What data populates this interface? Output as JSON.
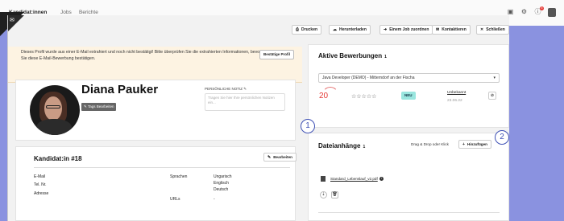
{
  "nav": {
    "tabs": [
      {
        "label": "Kandidat:innen",
        "active": true
      },
      {
        "label": "Jobs",
        "active": false
      },
      {
        "label": "Berichte",
        "active": false
      }
    ],
    "badge_count": "5"
  },
  "toolbar": {
    "print": "Drucken",
    "download": "Herunterladen",
    "assign_job": "Einem Job zuordnen",
    "contact": "Kontaktieren",
    "close": "Schließen"
  },
  "banner": {
    "text": "Dieses Profil wurde aus einer E-Mail extrahiert und noch nicht bestätigt! Bitte überprüfen Sie die extrahierten Informationen, bevor Sie diese E-Mail-Bewerbung bestätigen.",
    "confirm_label": "Bestätige Profil"
  },
  "profile": {
    "name": "Diana Pauker",
    "tags_button": "Tags Bearbeiten",
    "note_label": "PERSÖNLICHE NOTIZ",
    "note_placeholder": "Tragen Sie hier Ihre persönlichen Notizen ein..."
  },
  "candidate": {
    "title": "Kandidat:in #18",
    "edit": "Bearbeiten",
    "email_label": "E-Mail",
    "phone_label": "Tel. Nr.",
    "address_label": "Adresse",
    "languages_label": "Sprachen",
    "languages": [
      "Ungarisch",
      "Englisch",
      "Deutsch"
    ],
    "urls_label": "URLs",
    "urls_value": "-"
  },
  "applications": {
    "title": "Aktive Bewerbungen",
    "count": "1",
    "selected_job": "Java Developer (DEMO) - Mitterndorf an der Fischa",
    "score": "20",
    "stars": "☆☆☆☆☆",
    "status_badge": "NEU",
    "stage": "Unbekannt",
    "date": "23.06.22"
  },
  "attachments": {
    "title": "Dateianhänge",
    "count": "1",
    "drop_hint": "Drag & Drop oder Klick",
    "add_label": "Hinzufügen",
    "file": "Standard_Lebenslauf_v2.pdf"
  },
  "markers": {
    "one": "1",
    "two": "2"
  },
  "colors": {
    "backdrop": "#8a92e0",
    "banner": "#fdf3e2",
    "badge_neu": "#9ae6df",
    "score": "#e53935",
    "marker": "#3f51b5"
  }
}
